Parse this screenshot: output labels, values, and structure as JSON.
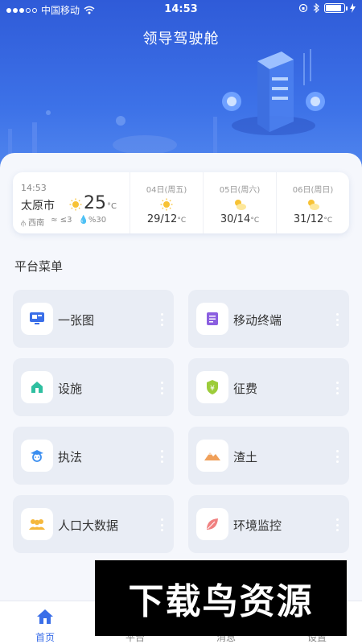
{
  "status_bar": {
    "carrier": "中国移动",
    "time": "14:53"
  },
  "header": {
    "title": "领导驾驶舱"
  },
  "weather": {
    "now": {
      "time": "14:53",
      "city": "太原市",
      "temp": "25",
      "unit": "°C",
      "wind_dir": "西南",
      "wind_level": "≤3",
      "humidity": "%30"
    },
    "forecast": [
      {
        "date": "04日(周五)",
        "range": "29/12",
        "unit": "°C",
        "icon": "sunny-icon"
      },
      {
        "date": "05日(周六)",
        "range": "30/14",
        "unit": "°C",
        "icon": "partly-cloudy-icon"
      },
      {
        "date": "06日(周日)",
        "range": "31/12",
        "unit": "°C",
        "icon": "partly-cloudy-icon"
      }
    ]
  },
  "menu": {
    "title": "平台菜单",
    "items": [
      {
        "label": "一张图",
        "icon": "monitor-icon"
      },
      {
        "label": "移动终端",
        "icon": "document-icon"
      },
      {
        "label": "设施",
        "icon": "house-icon"
      },
      {
        "label": "征费",
        "icon": "shield-yen-icon"
      },
      {
        "label": "执法",
        "icon": "officer-icon"
      },
      {
        "label": "渣土",
        "icon": "mountain-icon"
      },
      {
        "label": "人口大数据",
        "icon": "people-icon"
      },
      {
        "label": "环境监控",
        "icon": "leaf-icon"
      }
    ]
  },
  "tabbar": {
    "tabs": [
      {
        "label": "首页",
        "active": true
      },
      {
        "label": "平台"
      },
      {
        "label": "消息"
      },
      {
        "label": "设置"
      }
    ]
  },
  "watermark": {
    "text": "下载鸟资源"
  },
  "colors": {
    "accent": "#3a6ee8",
    "header_top": "#2f5bd8",
    "card_bg": "#e9edf5"
  }
}
